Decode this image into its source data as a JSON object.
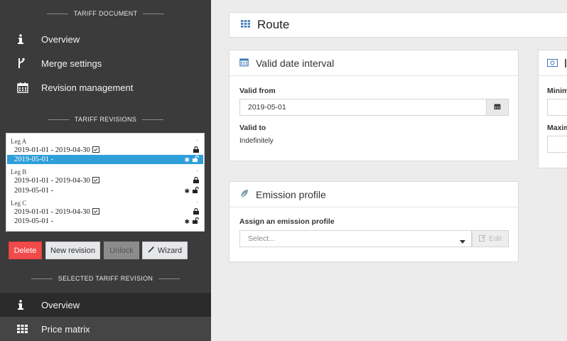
{
  "sidebar": {
    "section_tariff_document": "TARIFF DOCUMENT",
    "doc_items": [
      {
        "label": "Overview",
        "icon": "info-icon"
      },
      {
        "label": "Merge settings",
        "icon": "branch-icon"
      },
      {
        "label": "Revision management",
        "icon": "calendar-icon"
      }
    ],
    "section_tariff_revisions": "TARIFF REVISIONS",
    "legs": [
      {
        "name": "Leg A",
        "revisions": [
          "2019-01-01 - 2019-04-30",
          "2019-05-01 -"
        ]
      },
      {
        "name": "Leg B",
        "revisions": [
          "2019-01-01 - 2019-04-30",
          "2019-05-01 -"
        ]
      },
      {
        "name": "Leg C",
        "revisions": [
          "2019-01-01 - 2019-04-30",
          "2019-05-01 -"
        ]
      }
    ],
    "buttons": {
      "delete": "Delete",
      "new_revision": "New revision",
      "unlock": "Unlock",
      "wizard": "Wizard"
    },
    "section_selected_revision": "SELECTED TARIFF REVISION",
    "rev_items": [
      {
        "label": "Overview",
        "icon": "info-icon"
      },
      {
        "label": "Price matrix",
        "icon": "grid-icon"
      }
    ]
  },
  "main": {
    "route_title": "Route",
    "valid_interval": {
      "title": "Valid date interval",
      "valid_from_label": "Valid from",
      "valid_from_value": "2019-05-01",
      "valid_to_label": "Valid to",
      "valid_to_value": "Indefinitely"
    },
    "emission": {
      "title": "Emission profile",
      "assign_label": "Assign an emission profile",
      "select_placeholder": "Select...",
      "edit_label": "Edit"
    },
    "right_panel": {
      "label_min": "Minim",
      "label_max": "Maxim"
    }
  },
  "colors": {
    "accent": "#2f9fda",
    "danger": "#f04a4a",
    "sidebar": "#3b3b3b"
  }
}
